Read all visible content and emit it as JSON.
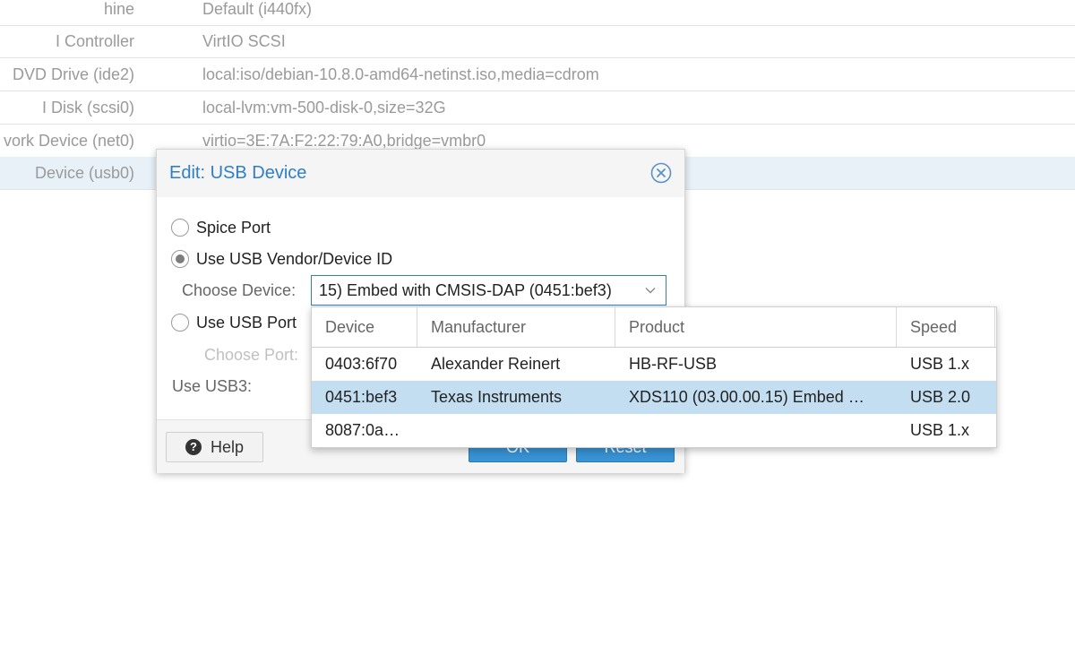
{
  "background_table": {
    "rows": [
      {
        "key": "hine",
        "value": "Default (i440fx)"
      },
      {
        "key": "I Controller",
        "value": "VirtIO SCSI"
      },
      {
        "key": "DVD Drive (ide2)",
        "value": "local:iso/debian-10.8.0-amd64-netinst.iso,media=cdrom"
      },
      {
        "key": "I Disk (scsi0)",
        "value": "local-lvm:vm-500-disk-0,size=32G"
      },
      {
        "key": "vork Device (net0)",
        "value": "virtio=3E:7A:F2:22:79:A0,bridge=vmbr0"
      },
      {
        "key": "Device (usb0)",
        "value": ""
      }
    ],
    "selected_row": 5
  },
  "dialog": {
    "title": "Edit: USB Device",
    "options": {
      "spice_port": "Spice Port",
      "vendor_device": "Use USB Vendor/Device ID",
      "usb_port": "Use USB Port"
    },
    "selected_option": "vendor_device",
    "choose_device_label": "Choose Device:",
    "choose_device_value": "15) Embed with CMSIS-DAP (0451:bef3)",
    "choose_port_label": "Choose Port:",
    "use_usb3_label": "Use USB3:",
    "help_label": "Help",
    "ok_label": "OK",
    "reset_label": "Reset"
  },
  "device_grid": {
    "columns": [
      "Device",
      "Manufacturer",
      "Product",
      "Speed"
    ],
    "rows": [
      {
        "device": "0403:6f70",
        "manufacturer": "Alexander Reinert",
        "product": "HB-RF-USB",
        "speed": "USB 1.x"
      },
      {
        "device": "0451:bef3",
        "manufacturer": "Texas Instruments",
        "product": "XDS110 (03.00.00.15) Embed …",
        "speed": "USB 2.0"
      },
      {
        "device": "8087:0a…",
        "manufacturer": "",
        "product": "",
        "speed": "USB 1.x"
      }
    ],
    "selected_row": 1
  },
  "colors": {
    "accent": "#2f7fc5",
    "selected_row": "#c4def1",
    "button_blue": "#3892d3"
  },
  "icons": [
    "close-circle-icon",
    "chevron-down-icon",
    "question-circle-icon"
  ]
}
